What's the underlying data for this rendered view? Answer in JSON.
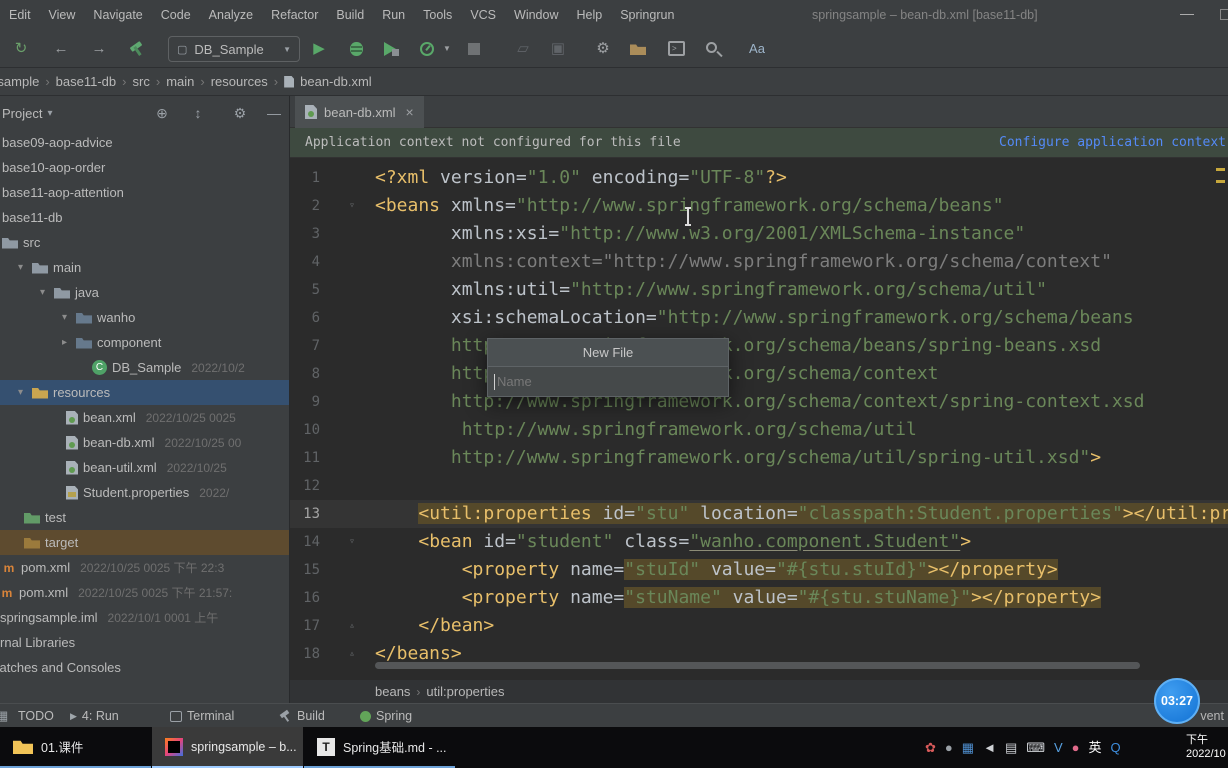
{
  "titlebar": {
    "menu": [
      "Edit",
      "View",
      "Navigate",
      "Code",
      "Analyze",
      "Refactor",
      "Build",
      "Run",
      "Tools",
      "VCS",
      "Window",
      "Help",
      "Springrun"
    ],
    "title": "springsample – bean-db.xml [base11-db]"
  },
  "toolbar": {
    "run_config": "DB_Sample"
  },
  "breadcrumbs": [
    "springsample",
    "base11-db",
    "src",
    "main",
    "resources",
    "bean-db.xml"
  ],
  "project_panel": {
    "title": "Project",
    "items": [
      {
        "pad": 2,
        "label": "base09-aop-advice"
      },
      {
        "pad": 2,
        "label": "base10-aop-order"
      },
      {
        "pad": 2,
        "label": "base11-aop-attention"
      },
      {
        "pad": 2,
        "label": "base11-db"
      },
      {
        "pad": 2,
        "icon": "folder",
        "label": "src"
      },
      {
        "pad": 18,
        "arrow": "v",
        "icon": "folder",
        "label": "main"
      },
      {
        "pad": 40,
        "arrow": "v",
        "icon": "folder",
        "label": "java"
      },
      {
        "pad": 62,
        "arrow": "v",
        "icon": "pkg",
        "label": "wanho"
      },
      {
        "pad": 62,
        "arrow": ">",
        "icon": "pkg",
        "label": "component"
      },
      {
        "pad": 92,
        "icon": "class",
        "label": "DB_Sample",
        "meta": "2022/10/2"
      },
      {
        "pad": 18,
        "arrow": "v",
        "icon": "res",
        "label": "resources",
        "cls": "selected"
      },
      {
        "pad": 66,
        "icon": "xml",
        "label": "bean.xml",
        "meta": "2022/10/25 0025"
      },
      {
        "pad": 66,
        "icon": "xml",
        "label": "bean-db.xml",
        "meta": "2022/10/25 00"
      },
      {
        "pad": 66,
        "icon": "xml",
        "label": "bean-util.xml",
        "meta": "2022/10/25"
      },
      {
        "pad": 66,
        "icon": "prop",
        "label": "Student.properties",
        "meta": "2022/"
      },
      {
        "pad": 24,
        "icon": "testf",
        "label": "test"
      },
      {
        "pad": 24,
        "icon": "targetf",
        "label": "target",
        "cls": "target"
      },
      {
        "pad": 2,
        "icon": "mvn",
        "label": "pom.xml",
        "meta": "2022/10/25 0025 下午 22:3"
      },
      {
        "pad": 0,
        "icon": "mvn",
        "label": "pom.xml",
        "meta": "2022/10/25 0025 下午 21:57:"
      },
      {
        "pad": 0,
        "label": "springsample.iml",
        "meta": "2022/10/1 0001 上午"
      },
      {
        "pad": 0,
        "cut": -26,
        "label": "External Libraries"
      },
      {
        "pad": 0,
        "cut": -20,
        "label": "Scratches and Consoles"
      }
    ]
  },
  "editor": {
    "tab": "bean-db.xml",
    "notification": {
      "message": "Application context not configured for this file",
      "action": "Configure application context"
    },
    "caret_line": 13,
    "lines": [
      {
        "seg": [
          [
            "tg",
            "<?xml "
          ],
          [
            "at",
            "version="
          ],
          [
            "st",
            "\"1.0\""
          ],
          [
            "at",
            " encoding="
          ],
          [
            "st",
            "\"UTF-8\""
          ],
          [
            "tg",
            "?>"
          ]
        ]
      },
      {
        "fold": "v",
        "seg": [
          [
            "tg",
            "<beans "
          ],
          [
            "at",
            "xmlns="
          ],
          [
            "st",
            "\"http://www.springframework.org/schema/beans\""
          ]
        ]
      },
      {
        "seg": [
          [
            "pl",
            "       "
          ],
          [
            "at",
            "xmlns:xsi="
          ],
          [
            "st",
            "\"http://www.w3.org/2001/XMLSchema-instance\""
          ]
        ]
      },
      {
        "seg": [
          [
            "pl",
            "       "
          ],
          [
            "gr",
            "xmlns:context="
          ],
          [
            "gr",
            "\"http://www.springframework.org/schema/context\""
          ]
        ]
      },
      {
        "seg": [
          [
            "pl",
            "       "
          ],
          [
            "at",
            "xmlns:util="
          ],
          [
            "st",
            "\"http://www.springframework.org/schema/util\""
          ]
        ]
      },
      {
        "seg": [
          [
            "pl",
            "       "
          ],
          [
            "at",
            "xsi:schemaLocation="
          ],
          [
            "st",
            "\"http://www.springframework.org/schema/beans"
          ]
        ]
      },
      {
        "seg": [
          [
            "st",
            "       http://www.springframework.org/schema/beans/spring-beans.xsd"
          ]
        ]
      },
      {
        "seg": [
          [
            "st",
            "       http://www.springframework.org/schema/context"
          ]
        ]
      },
      {
        "seg": [
          [
            "st",
            "       http://www.springframework.org/schema/context/spring-context.xsd"
          ]
        ]
      },
      {
        "seg": [
          [
            "st",
            "        http://www.springframework.org/schema/util"
          ]
        ]
      },
      {
        "seg": [
          [
            "st",
            "       http://www.springframework.org/schema/util/spring-util.xsd\""
          ],
          [
            "tg",
            ">"
          ]
        ]
      },
      {
        "seg": []
      },
      {
        "seg": [
          [
            "pl",
            "    "
          ],
          [
            "tg hl",
            "<util:properties"
          ],
          [
            "at hl",
            " id="
          ],
          [
            "st hl",
            "\"stu\""
          ],
          [
            "at hl",
            " location="
          ],
          [
            "st hl",
            "\"classpath:Student.properties\""
          ],
          [
            "tg hl",
            "></util:properties>"
          ]
        ]
      },
      {
        "fold": "v",
        "seg": [
          [
            "pl",
            "    "
          ],
          [
            "tg",
            "<bean "
          ],
          [
            "at",
            "id="
          ],
          [
            "st",
            "\"student\""
          ],
          [
            "at",
            " class="
          ],
          [
            "st u",
            "\"wanho.component.Student\""
          ],
          [
            "tg",
            ">"
          ]
        ]
      },
      {
        "seg": [
          [
            "pl",
            "        "
          ],
          [
            "tg",
            "<property "
          ],
          [
            "at",
            "name="
          ],
          [
            "st hl",
            "\"stuId\""
          ],
          [
            "at hl",
            " value="
          ],
          [
            "st hl",
            "\"#{stu.stuId}\""
          ],
          [
            "tg hl",
            "></property>"
          ]
        ]
      },
      {
        "seg": [
          [
            "pl",
            "        "
          ],
          [
            "tg",
            "<property "
          ],
          [
            "at",
            "name="
          ],
          [
            "st hl",
            "\"stuName\""
          ],
          [
            "at hl",
            " value="
          ],
          [
            "st hl",
            "\"#{stu.stuName}\""
          ],
          [
            "tg hl",
            "></property>"
          ]
        ]
      },
      {
        "fold": "^",
        "seg": [
          [
            "pl",
            "    "
          ],
          [
            "tg",
            "</bean>"
          ]
        ]
      },
      {
        "fold": "^",
        "seg": [
          [
            "tg",
            "</beans>"
          ]
        ]
      }
    ],
    "popup": {
      "title": "New File",
      "placeholder": "Name"
    },
    "breadcrumb": [
      "beans",
      "util:properties"
    ]
  },
  "statusbar": {
    "items": [
      {
        "label": "TODO"
      },
      {
        "icon": "run",
        "label": "4: Run"
      },
      {
        "icon": "term",
        "label": "Terminal"
      },
      {
        "icon": "build",
        "label": "Build"
      },
      {
        "icon": "spring",
        "label": "Spring"
      }
    ],
    "right_text": "vent"
  },
  "overlay": {
    "timer": "03:27"
  },
  "taskbar": {
    "apps": [
      {
        "label": "01.课件",
        "icon": "folder"
      },
      {
        "label": "springsample – b...",
        "icon": "idea",
        "active": true
      },
      {
        "label": "Spring基础.md - ...",
        "icon": "typora"
      }
    ],
    "typora_letter": "T",
    "tray": [
      {
        "name": "tray-flower-icon",
        "glyph": "✿",
        "color": "#d85a5a"
      },
      {
        "name": "tray-circle-icon",
        "glyph": "●",
        "color": "#9aa0a6"
      },
      {
        "name": "tray-grid-icon",
        "glyph": "▦",
        "color": "#4f8fd0"
      },
      {
        "name": "tray-volume-icon",
        "glyph": "◄",
        "color": "#cfd2d6"
      },
      {
        "name": "tray-battery-icon",
        "glyph": "▤",
        "color": "#cfd2d6"
      },
      {
        "name": "tray-keyboard-icon",
        "glyph": "⌨",
        "color": "#cfd2d6"
      },
      {
        "name": "tray-v-icon",
        "glyph": "V",
        "color": "#57a0e0"
      },
      {
        "name": "tray-dot-icon",
        "glyph": "●",
        "color": "#e06a8a"
      },
      {
        "name": "tray-ime-icon",
        "glyph": "英",
        "color": "#ffffff"
      },
      {
        "name": "tray-q-icon",
        "glyph": "Q",
        "color": "#3e8ede"
      }
    ],
    "clock_line1": "下午",
    "clock_line2": "2022/10"
  },
  "icons": {
    "sync": "↻",
    "back": "←",
    "forward": "→",
    "play": "▶",
    "caret_down": "▼",
    "wrench": "⚙",
    "translate": "Aa",
    "dim1": "▱",
    "dim2": "▣",
    "minimize": "—",
    "locate": "⊕",
    "expand_all": "↕",
    "gear": "⚙",
    "hide": "—",
    "project_caret": "▾",
    "tab_close": "×",
    "combo_icon": "▢",
    "terminal_prompt": ">"
  }
}
